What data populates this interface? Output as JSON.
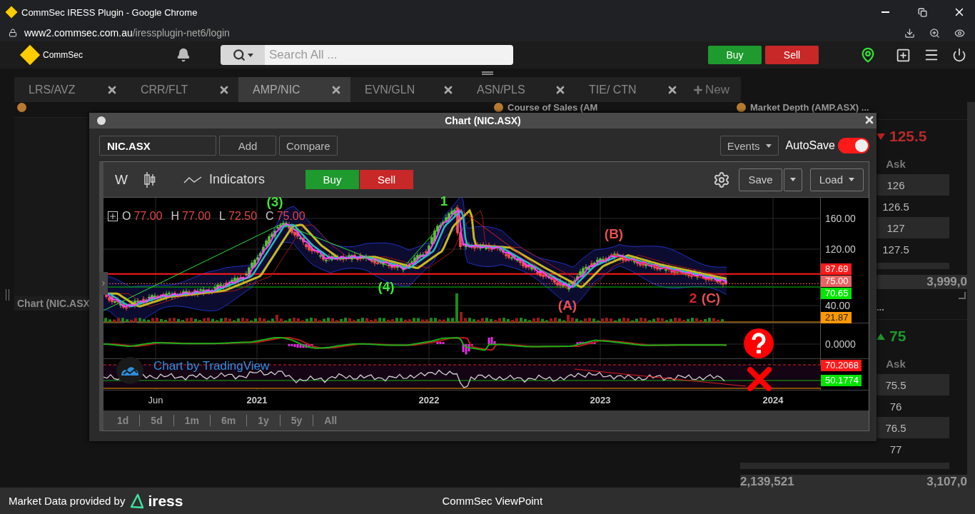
{
  "browser": {
    "title": "CommSec IRESS Plugin - Google Chrome",
    "url_host": "www2.commsec.com.au",
    "url_path": "/iressplugin-net6/login"
  },
  "app_header": {
    "logo": "CommSec",
    "search": {
      "placeholder": "Search All ..."
    },
    "buy": "Buy",
    "sell": "Sell"
  },
  "tabs": [
    {
      "label": "LRS/AVZ",
      "selected": false
    },
    {
      "label": "CRR/FLT",
      "selected": false
    },
    {
      "label": "AMP/NIC",
      "selected": true
    },
    {
      "label": "EVN/GLN",
      "selected": false
    },
    {
      "label": "ASN/PLS",
      "selected": false
    },
    {
      "label": "TIE/ CTN",
      "selected": false
    }
  ],
  "new_tab": "New",
  "left_panel": {
    "label": "Chart (NIC.ASX"
  },
  "course_panel": {
    "title": "Course of Sales (AM"
  },
  "depth_panels": [
    {
      "title": "Market Depth (AMP.ASX) ...",
      "rising": false,
      "price": "125.5",
      "ask_header": "Ask",
      "asks": [
        "126",
        "126.5",
        "127",
        "127.5"
      ],
      "total_ask": "3,999,0"
    },
    {
      "title": "...",
      "rising": true,
      "price": "75",
      "ask_header": "Ask",
      "asks": [
        "75.5",
        "76",
        "76.5",
        "77"
      ],
      "total_bid": "2,139,521",
      "total_ask": "3,107,0"
    }
  ],
  "chart_window": {
    "title": "Chart (NIC.ASX)",
    "symbol": "NIC.ASX",
    "add": "Add",
    "compare": "Compare",
    "events": "Events",
    "autosave": {
      "label": "AutoSave",
      "on": true
    },
    "interval": "W",
    "indicators": "Indicators",
    "buy": "Buy",
    "sell": "Sell",
    "save": "Save",
    "load": "Load",
    "legend": [
      {
        "key": "O",
        "value": "77.00"
      },
      {
        "key": "H",
        "value": "77.00"
      },
      {
        "key": "L",
        "value": "72.50"
      },
      {
        "key": "C",
        "value": "75.00"
      }
    ],
    "price_ticks": [
      "160.00",
      "120.00",
      "40.00"
    ],
    "price_tags": [
      {
        "label": "87.69",
        "color": "#ff1a1a"
      },
      {
        "label": "75.00",
        "color": "#e86464"
      },
      {
        "label": "70.65",
        "color": "#00e600"
      },
      {
        "label": "21.87",
        "color": "#ff9800"
      }
    ],
    "wave_labels": [
      {
        "text": "(3)",
        "color": "#3ee03e"
      },
      {
        "text": "1",
        "color": "#3ee03e"
      },
      {
        "text": "(4)",
        "color": "#3ee03e"
      },
      {
        "text": "(B)",
        "color": "#e85050"
      },
      {
        "text": "(A)",
        "color": "#e85050"
      },
      {
        "text": "2",
        "color": "#e02020"
      },
      {
        "text": "(C)",
        "color": "#e85050"
      }
    ],
    "macd_tick": "0.0000",
    "rsi_tags": [
      {
        "label": "70.2068",
        "color": "#ff1a1a"
      },
      {
        "label": "50.1774",
        "color": "#00e600"
      }
    ],
    "watermark": "Chart by TradingView",
    "time_labels": [
      {
        "text": "Jun",
        "kind": "month"
      },
      {
        "text": "2021",
        "kind": "year"
      },
      {
        "text": "2022",
        "kind": "year"
      },
      {
        "text": "2023",
        "kind": "year"
      },
      {
        "text": "2024",
        "kind": "year"
      }
    ],
    "ranges": [
      "1d",
      "5d",
      "1m",
      "6m",
      "1y",
      "5y",
      "All"
    ]
  },
  "footer": {
    "provided_by": "Market Data provided by",
    "provider": "iress",
    "title": "CommSec ViewPoint"
  }
}
